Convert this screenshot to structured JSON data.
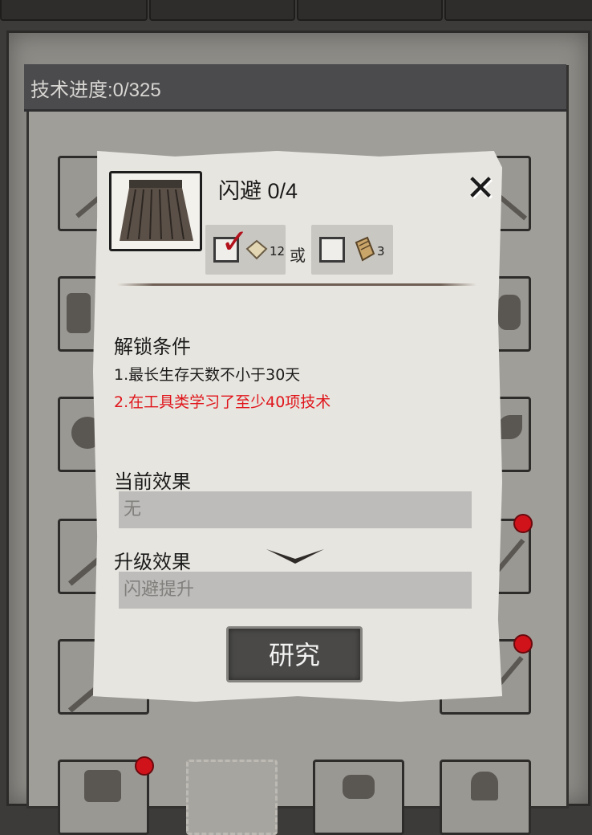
{
  "header": {
    "tech_progress": "技术进度:0/325"
  },
  "popup": {
    "title": "闪避 0/4",
    "item_icon": "skirt-armor-icon",
    "close_icon": "close-icon",
    "cost_option_1": {
      "icon": "paper-scroll-icon",
      "count": "12",
      "checked": true
    },
    "or_label": "或",
    "cost_option_2": {
      "icon": "book-icon",
      "count": "3",
      "checked": false
    },
    "unlock_section": {
      "title": "解锁条件",
      "conditions": [
        {
          "text": "1.最长生存天数不小于30天",
          "met": true
        },
        {
          "text": "2.在工具类学习了至少40项技术",
          "met": false
        }
      ]
    },
    "current_effect": {
      "title": "当前效果",
      "value": "无"
    },
    "upgrade_effect": {
      "title": "升级效果",
      "value": "闪避提升"
    },
    "research_label": "研究"
  },
  "colors": {
    "unmet_condition": "#e0161c",
    "notification_dot": "#d0121b",
    "popup_paper": "#e7e5df"
  }
}
